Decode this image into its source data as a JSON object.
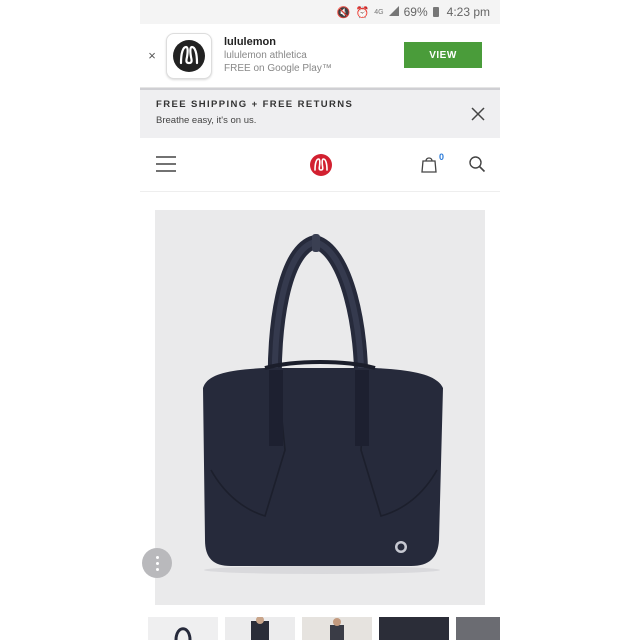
{
  "status_bar": {
    "battery": "69%",
    "time": "4:23 pm",
    "network": "4G",
    "icons": [
      "mute-icon",
      "alarm-icon",
      "network-icon",
      "signal-icon",
      "battery-icon"
    ]
  },
  "app_banner": {
    "close": "×",
    "app_name": "lululemon",
    "developer": "lululemon athletica",
    "store": "FREE on Google Play™",
    "cta": "VIEW"
  },
  "shipping_banner": {
    "title": "FREE SHIPPING + FREE RETURNS",
    "subtitle": "Breathe easy, it's on us."
  },
  "nav": {
    "bag_count": "0"
  },
  "colors": {
    "brand_red": "#d22030",
    "view_green": "#4a9c3a",
    "bag_navy": "#262a3b",
    "badge_blue": "#2b7bd9"
  },
  "product": {
    "image": "navy-leather-tote-bag"
  }
}
